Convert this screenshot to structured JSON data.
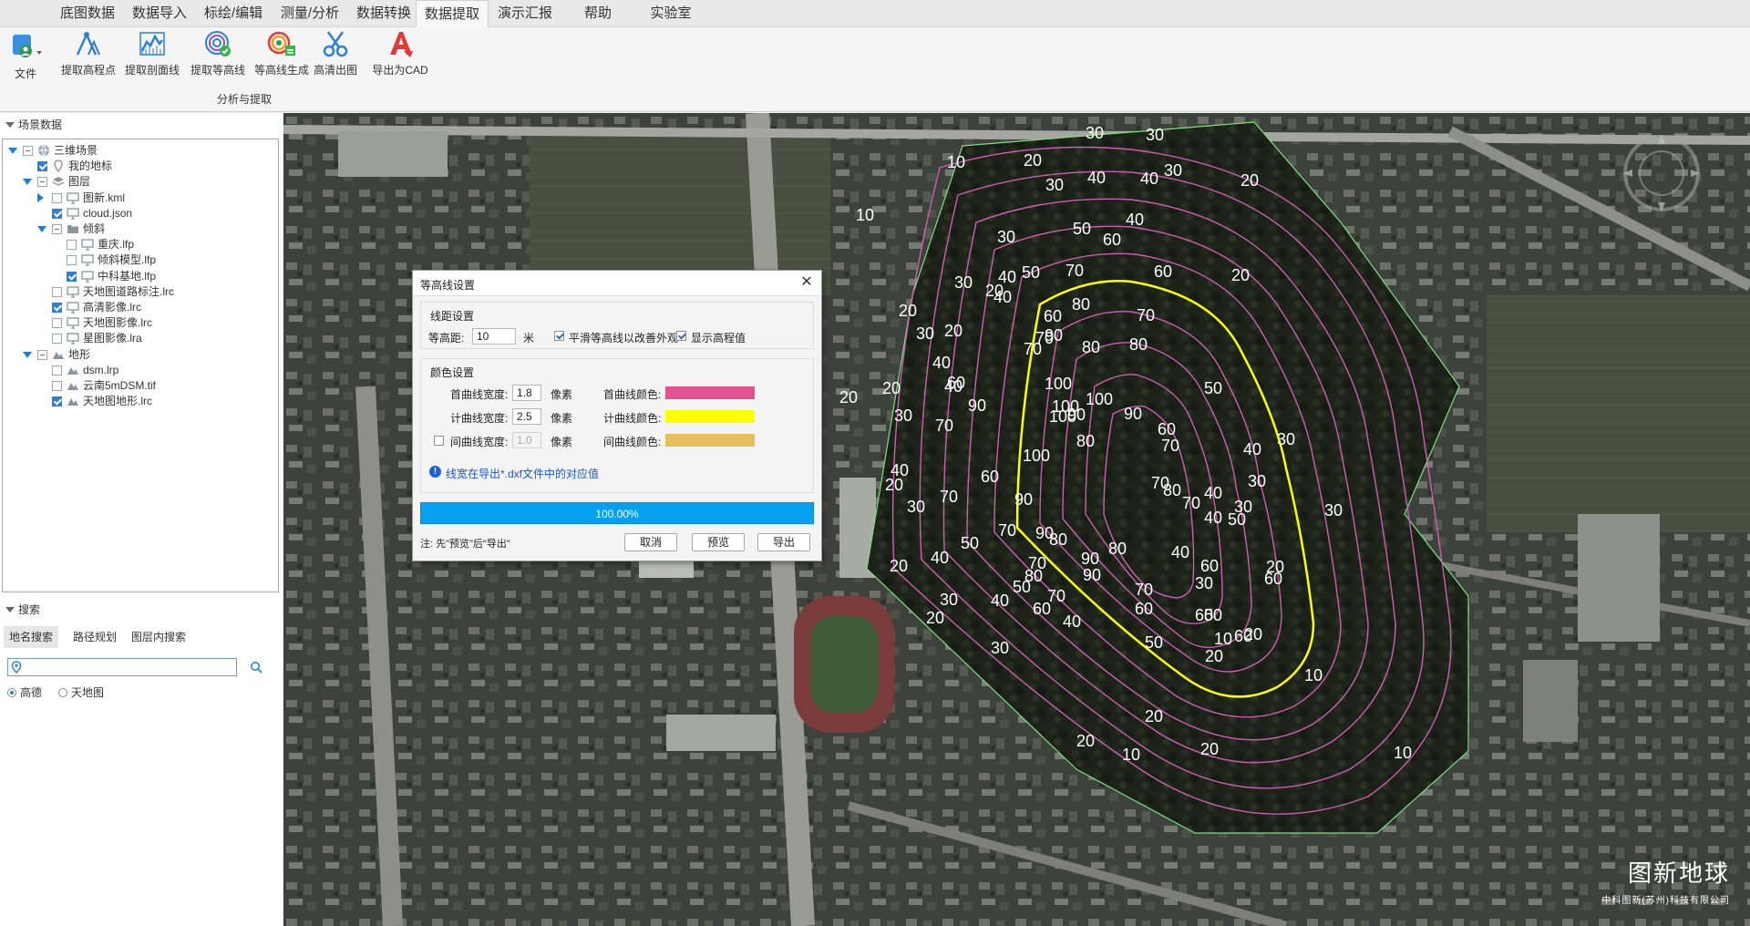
{
  "menu": [
    "底图数据",
    "数据导入",
    "标绘/编辑",
    "测量/分析",
    "数据转换",
    "数据提取",
    "演示汇报",
    "帮助",
    "实验室"
  ],
  "menu_active": "数据提取",
  "ribbon": {
    "file_label": "文件",
    "tools": [
      "提取高程点",
      "提取剖面线",
      "提取等高线",
      "等高线生成",
      "高清出图",
      "导出为CAD"
    ],
    "group_label": "分析与提取"
  },
  "scene_panel": {
    "title": "场景数据",
    "tree": [
      {
        "label": "三维场景",
        "level": 0,
        "expanded": true,
        "check": "partial",
        "icon": "globe-icon"
      },
      {
        "label": "我的地标",
        "level": 1,
        "check": "checked",
        "icon": "pin-icon"
      },
      {
        "label": "图层",
        "level": 1,
        "expanded": true,
        "check": "partial",
        "icon": "layers-icon"
      },
      {
        "label": "图新.kml",
        "level": 2,
        "expanded": false,
        "check": "unchecked",
        "icon": "monitor-icon"
      },
      {
        "label": "cloud.json",
        "level": 2,
        "check": "checked",
        "icon": "monitor-icon"
      },
      {
        "label": "倾斜",
        "level": 2,
        "expanded": true,
        "check": "partial",
        "icon": "folder-icon"
      },
      {
        "label": "重庆.lfp",
        "level": 3,
        "check": "unchecked",
        "icon": "monitor-icon"
      },
      {
        "label": "倾斜模型.lfp",
        "level": 3,
        "check": "unchecked",
        "icon": "monitor-icon"
      },
      {
        "label": "中科基地.lfp",
        "level": 3,
        "check": "checked",
        "icon": "monitor-icon"
      },
      {
        "label": "天地图道路标注.lrc",
        "level": 2,
        "check": "unchecked",
        "icon": "monitor-icon"
      },
      {
        "label": "高清影像.lrc",
        "level": 2,
        "check": "checked",
        "icon": "monitor-icon"
      },
      {
        "label": "天地图影像.lrc",
        "level": 2,
        "check": "unchecked",
        "icon": "monitor-icon"
      },
      {
        "label": "星图影像.lra",
        "level": 2,
        "check": "unchecked",
        "icon": "monitor-icon"
      },
      {
        "label": "地形",
        "level": 1,
        "expanded": true,
        "check": "partial",
        "icon": "terrain-icon"
      },
      {
        "label": "dsm.lrp",
        "level": 2,
        "check": "unchecked",
        "icon": "terrain-icon"
      },
      {
        "label": "云南5mDSM.tif",
        "level": 2,
        "check": "unchecked",
        "icon": "terrain-icon"
      },
      {
        "label": "天地图地形.lrc",
        "level": 2,
        "check": "checked",
        "icon": "terrain-icon"
      }
    ]
  },
  "search_panel": {
    "title": "搜索",
    "tabs": [
      "地名搜索",
      "路径规划",
      "图层内搜索"
    ],
    "active_tab": "地名搜索",
    "input_value": "",
    "input_placeholder": "",
    "radios": [
      {
        "label": "高德",
        "selected": true
      },
      {
        "label": "天地图",
        "selected": false
      }
    ]
  },
  "dialog": {
    "title": "等高线设置",
    "close": "✕",
    "spacing_group": "线距设置",
    "spacing_label": "等高距:",
    "spacing_value": "10",
    "spacing_unit": "米",
    "smooth_label": "平滑等高线以改善外观",
    "smooth_checked": true,
    "show_elev_label": "显示高程值",
    "show_elev_checked": true,
    "color_group": "颜色设置",
    "rows": [
      {
        "width_label": "首曲线宽度:",
        "width_value": "1.8",
        "unit": "像素",
        "color_label": "首曲线颜色:",
        "color": "#e0538f",
        "enabled": true
      },
      {
        "width_label": "计曲线宽度:",
        "width_value": "2.5",
        "unit": "像素",
        "color_label": "计曲线颜色:",
        "color": "#ffff00",
        "enabled": true
      },
      {
        "width_label": "间曲线宽度:",
        "width_value": "1.0",
        "unit": "像素",
        "color_label": "间曲线颜色:",
        "color": "#e6be5c",
        "enabled": false
      }
    ],
    "info": "线宽在导出*.dxf文件中的对应值",
    "progress": "100.00%",
    "progress_value": 1.0,
    "note": "注: 先\"预览\"后\"导出\"",
    "buttons": [
      "取消",
      "预览",
      "导出"
    ]
  },
  "map": {
    "contour_labels": [
      "10",
      "10",
      "10",
      "10",
      "10",
      "10",
      "20",
      "20",
      "20",
      "20",
      "20",
      "20",
      "20",
      "20",
      "20",
      "20",
      "20",
      "20",
      "20",
      "20",
      "20",
      "20",
      "20",
      "30",
      "30",
      "30",
      "30",
      "30",
      "30",
      "30",
      "30",
      "30",
      "30",
      "30",
      "30",
      "30",
      "30",
      "30",
      "30",
      "40",
      "40",
      "40",
      "40",
      "40",
      "40",
      "40",
      "40",
      "40",
      "40",
      "40",
      "40",
      "40",
      "40",
      "40",
      "50",
      "50",
      "50",
      "50",
      "50",
      "50",
      "50",
      "50",
      "60",
      "60",
      "60",
      "60",
      "60",
      "60",
      "60",
      "60",
      "60",
      "60",
      "60",
      "60",
      "70",
      "70",
      "70",
      "70",
      "70",
      "70",
      "70",
      "70",
      "70",
      "70",
      "70",
      "70",
      "70",
      "80",
      "80",
      "80",
      "80",
      "80",
      "80",
      "80",
      "80",
      "90",
      "90",
      "90",
      "90",
      "90",
      "90",
      "90",
      "90",
      "100",
      "100",
      "100",
      "100",
      "100"
    ],
    "contour_colors": {
      "index": "#ffff00",
      "regular": "#cc5fb2",
      "boundary": "#7fe07f"
    }
  },
  "brand": {
    "title": "图新地球",
    "subtitle": "中科图新(苏州)科技有限公司"
  }
}
